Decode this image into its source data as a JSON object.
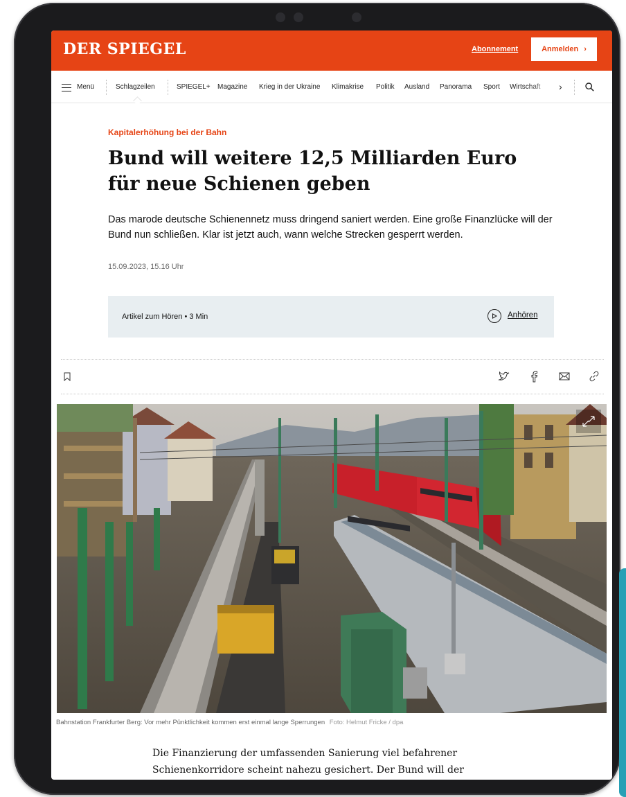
{
  "header": {
    "logo": "DER SPIEGEL",
    "subscription_label": "Abonnement",
    "login_label": "Anmelden",
    "login_chevron": "›"
  },
  "nav": {
    "menu_label": "Menü",
    "items": [
      "Schlagzeilen",
      "SPIEGEL+",
      "Magazine",
      "Krieg in der Ukraine",
      "Klimakrise",
      "Politik",
      "Ausland",
      "Panorama",
      "Sport",
      "Wirtschaft"
    ],
    "more_chevron": "›",
    "search_icon": "search-icon"
  },
  "article": {
    "kicker": "Kapitalerhöhung bei der Bahn",
    "headline": "Bund will weitere 12,5 Milliarden Euro für neue Schienen geben",
    "lead": "Das marode deutsche Schienennetz muss dringend saniert werden. Eine große Finanzlücke will der Bund nun schließen. Klar ist jetzt auch, wann welche Strecken gesperrt werden.",
    "date": "15.09.2023, 15.16 Uhr",
    "audio_label": "Artikel zum Hören • 3 Min",
    "listen_label": "Anhören",
    "caption": "Bahnstation Frankfurter Berg: Vor mehr Pünktlichkeit kommen erst einmal lange Sperrungen",
    "photo_credit": "Foto: Helmut Fricke / dpa",
    "body": "Die Finanzierung der umfassenden Sanierung viel befahrener Schienenkorridore scheint nahezu gesichert. Der Bund will der"
  },
  "colors": {
    "brand": "#e64415",
    "audio_bg": "#e8eef1",
    "train": "#d0202a"
  }
}
